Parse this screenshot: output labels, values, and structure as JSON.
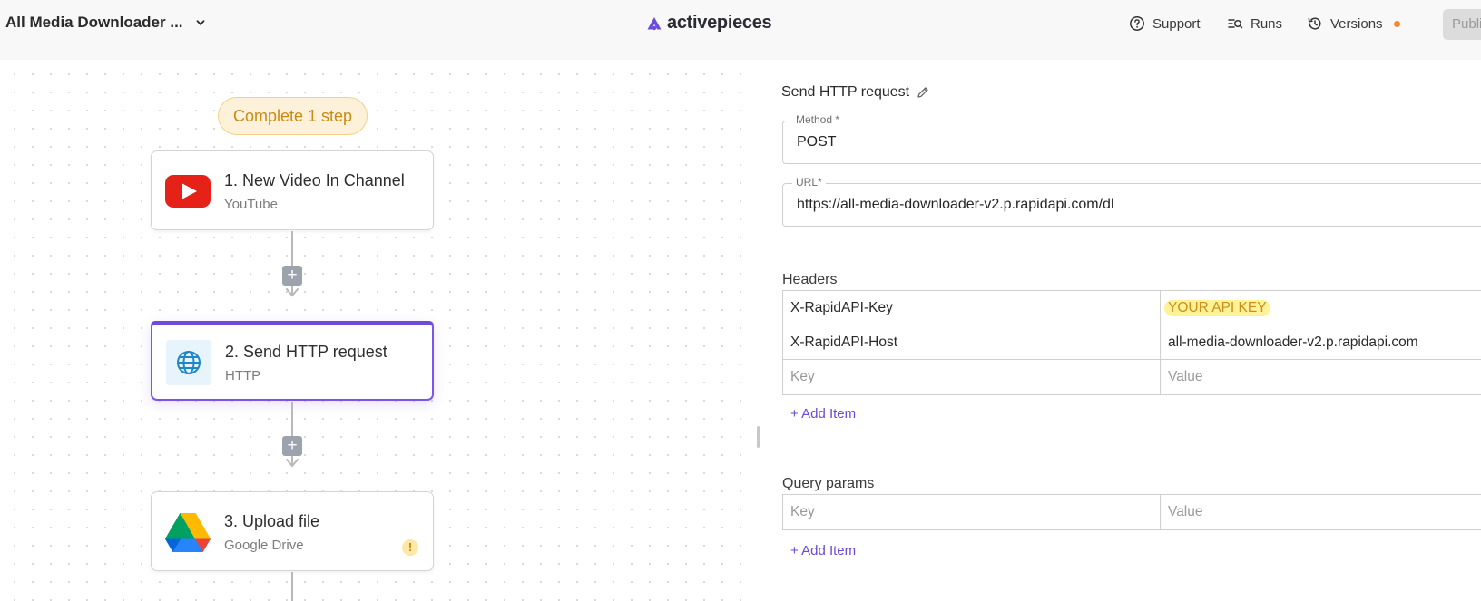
{
  "header": {
    "flow_title": "All Media Downloader ...",
    "brand": "activepieces",
    "support": "Support",
    "runs": "Runs",
    "versions": "Versions",
    "publish": "Publi"
  },
  "canvas": {
    "incomplete_pill": "Complete 1 step",
    "steps": [
      {
        "title": "1. New Video In Channel",
        "subtitle": "YouTube",
        "icon": "youtube-icon"
      },
      {
        "title": "2. Send HTTP request",
        "subtitle": "HTTP",
        "icon": "globe-icon"
      },
      {
        "title": "3. Upload file",
        "subtitle": "Google Drive",
        "icon": "google-drive-icon"
      }
    ],
    "warning_glyph": "!"
  },
  "panel": {
    "title": "Send HTTP request",
    "method": {
      "label": "Method *",
      "value": "POST"
    },
    "url": {
      "label": "URL*",
      "value": "https://all-media-downloader-v2.p.rapidapi.com/dl"
    },
    "headers": {
      "label": "Headers",
      "rows": [
        {
          "key": "X-RapidAPI-Key",
          "value": "YOUR API KEY"
        },
        {
          "key": "X-RapidAPI-Host",
          "value": "all-media-downloader-v2.p.rapidapi.com"
        }
      ],
      "key_placeholder": "Key",
      "value_placeholder": "Value",
      "add_item": "+ Add Item"
    },
    "query_params": {
      "label": "Query params",
      "key_placeholder": "Key",
      "value_placeholder": "Value",
      "add_item": "+ Add Item"
    }
  },
  "colors": {
    "accent": "#6f4cd8",
    "pill_bg": "#fdf2d9",
    "pill_text": "#c98a14",
    "highlight": "#fff39a",
    "versions_dot": "#f5892a"
  }
}
